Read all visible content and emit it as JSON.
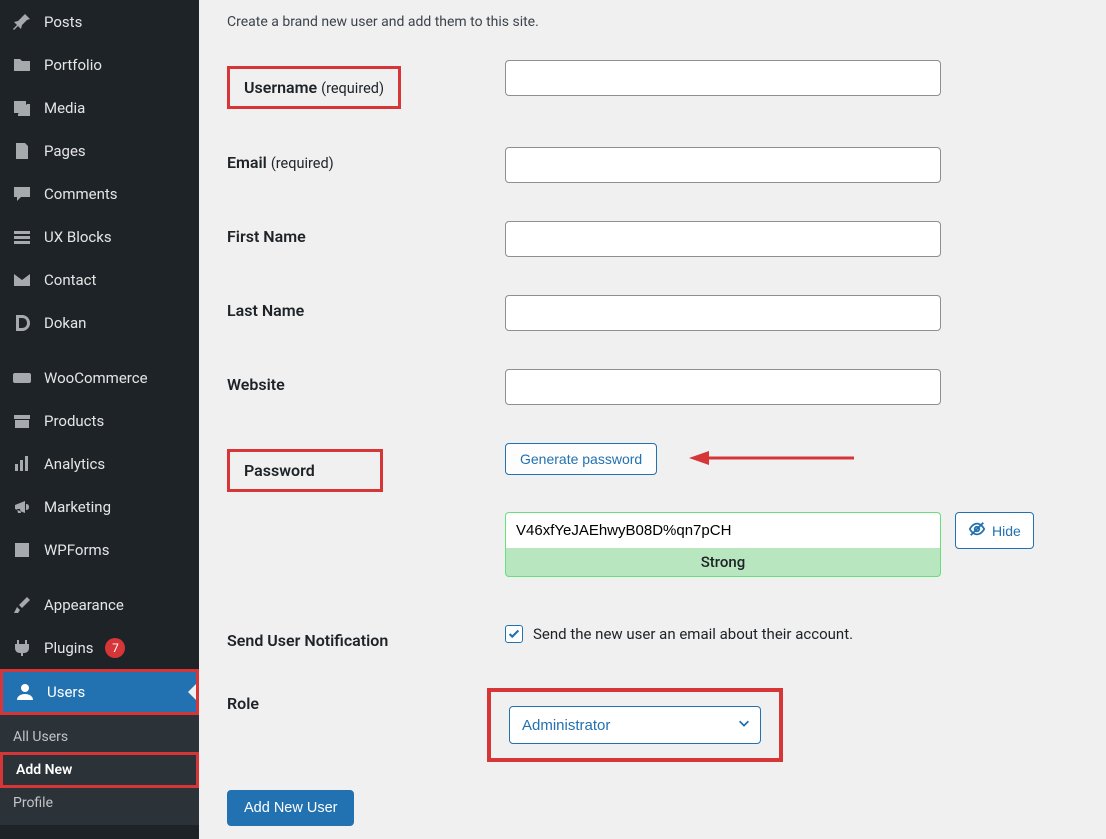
{
  "sidebar": {
    "items": [
      {
        "label": "Posts",
        "icon": "pin"
      },
      {
        "label": "Portfolio",
        "icon": "folder"
      },
      {
        "label": "Media",
        "icon": "media"
      },
      {
        "label": "Pages",
        "icon": "pages"
      },
      {
        "label": "Comments",
        "icon": "comment"
      },
      {
        "label": "UX Blocks",
        "icon": "blocks"
      },
      {
        "label": "Contact",
        "icon": "mail"
      },
      {
        "label": "Dokan",
        "icon": "dokan"
      },
      {
        "label": "WooCommerce",
        "icon": "woo"
      },
      {
        "label": "Products",
        "icon": "archive"
      },
      {
        "label": "Analytics",
        "icon": "bars"
      },
      {
        "label": "Marketing",
        "icon": "megaphone"
      },
      {
        "label": "WPForms",
        "icon": "forms"
      },
      {
        "label": "Appearance",
        "icon": "brush"
      },
      {
        "label": "Plugins",
        "icon": "plug",
        "badge": "7"
      },
      {
        "label": "Users",
        "icon": "user",
        "current": true
      }
    ],
    "sub": {
      "all": "All Users",
      "addnew": "Add New",
      "profile": "Profile"
    }
  },
  "form": {
    "intro": "Create a brand new user and add them to this site.",
    "username_label": "Username",
    "email_label": "Email",
    "required_suffix": "(required)",
    "firstname_label": "First Name",
    "lastname_label": "Last Name",
    "website_label": "Website",
    "password_label": "Password",
    "generate_btn": "Generate password",
    "password_value": "V46xfYeJAEhwyB08D%qn7pCH",
    "hide_btn": "Hide",
    "strength_label": "Strong",
    "notify_label": "Send User Notification",
    "notify_text": "Send the new user an email about their account.",
    "role_label": "Role",
    "role_value": "Administrator",
    "submit_label": "Add New User"
  }
}
